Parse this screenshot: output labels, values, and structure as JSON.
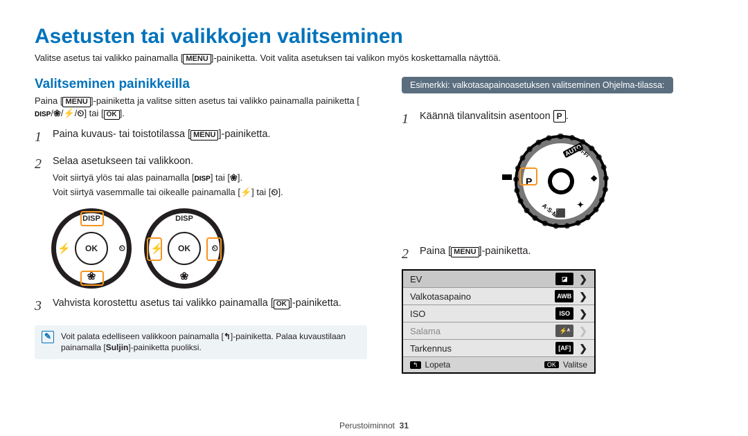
{
  "title": "Asetusten tai valikkojen valitseminen",
  "intro_before": "Valitse asetus tai valikko painamalla [",
  "intro_menu": "MENU",
  "intro_after": "]-painiketta. Voit valita asetuksen tai valikon myös koskettamalla näyttöä.",
  "left": {
    "subhead": "Valitseminen painikkeilla",
    "para_before": "Paina [",
    "para_menu": "MENU",
    "para_mid": "]-painiketta ja valitse sitten asetus tai valikko painamalla painiketta [",
    "para_disp": "DISP",
    "para_sep1": "/",
    "para_flower": "❀",
    "para_sep2": "/",
    "para_flash": "⚡",
    "para_sep3": "/",
    "para_timer": "⏲",
    "para_after1": "] tai [",
    "para_ok": "OK",
    "para_after2": "].",
    "step1_num": "1",
    "step1_before": "Paina kuvaus- tai toistotilassa [",
    "step1_menu": "MENU",
    "step1_after": "]-painiketta.",
    "step2_num": "2",
    "step2_text": "Selaa asetukseen tai valikkoon.",
    "step2_sub1_before": "Voit siirtyä ylös tai alas painamalla [",
    "step2_sub1_disp": "DISP",
    "step2_sub1_mid": "] tai [",
    "step2_sub1_flower": "❀",
    "step2_sub1_after": "].",
    "step2_sub2_before": "Voit siirtyä vasemmalle tai oikealle painamalla [",
    "step2_sub2_flash": "⚡",
    "step2_sub2_mid": "] tai [",
    "step2_sub2_timer": "⏲",
    "step2_sub2_after": "].",
    "wheel_ok": "OK",
    "wheel_disp": "DISP",
    "wheel_flower": "❀",
    "wheel_flash": "⚡",
    "wheel_timer": "⏲",
    "step3_num": "3",
    "step3_before": "Vahvista korostettu asetus tai valikko painamalla [",
    "step3_ok": "OK",
    "step3_after": "]-painiketta.",
    "note_before": "Voit palata edelliseen valikkoon painamalla [",
    "note_back": "↰",
    "note_mid": "]-painiketta. Palaa kuvaustilaan painamalla [",
    "note_bold": "Suljin",
    "note_after": "]-painiketta puoliksi."
  },
  "right": {
    "example": "Esimerkki: valkotasapainoasetuksen valitseminen Ohjelma-tilassa:",
    "step1_num": "1",
    "step1_before": "Käännä tilanvalitsin asentoon ",
    "step1_p": "P",
    "step1_after": ".",
    "dial": {
      "auto": "AUTO",
      "wifi": "Wi-Fi",
      "p": "P",
      "asm": "A·S·M",
      "s1": "⬛",
      "s2": "✦",
      "s3": "❖"
    },
    "step2_num": "2",
    "step2_before": "Paina [",
    "step2_menu": "MENU",
    "step2_after": "]-painiketta.",
    "menu": {
      "items": [
        {
          "label": "EV",
          "icon": "◪",
          "sel": true
        },
        {
          "label": "Valkotasapaino",
          "icon": "AWB",
          "sel": false
        },
        {
          "label": "ISO",
          "icon": "ISO",
          "sel": false
        },
        {
          "label": "Salama",
          "icon": "⚡ᴬ",
          "dis": true
        },
        {
          "label": "Tarkennus",
          "icon": "[AF]",
          "sel": false
        }
      ],
      "footer_back_key": "↰",
      "footer_back": "Lopeta",
      "footer_ok_key": "OK",
      "footer_ok": "Valitse"
    }
  },
  "footer": {
    "section": "Perustoiminnot",
    "page": "31"
  }
}
